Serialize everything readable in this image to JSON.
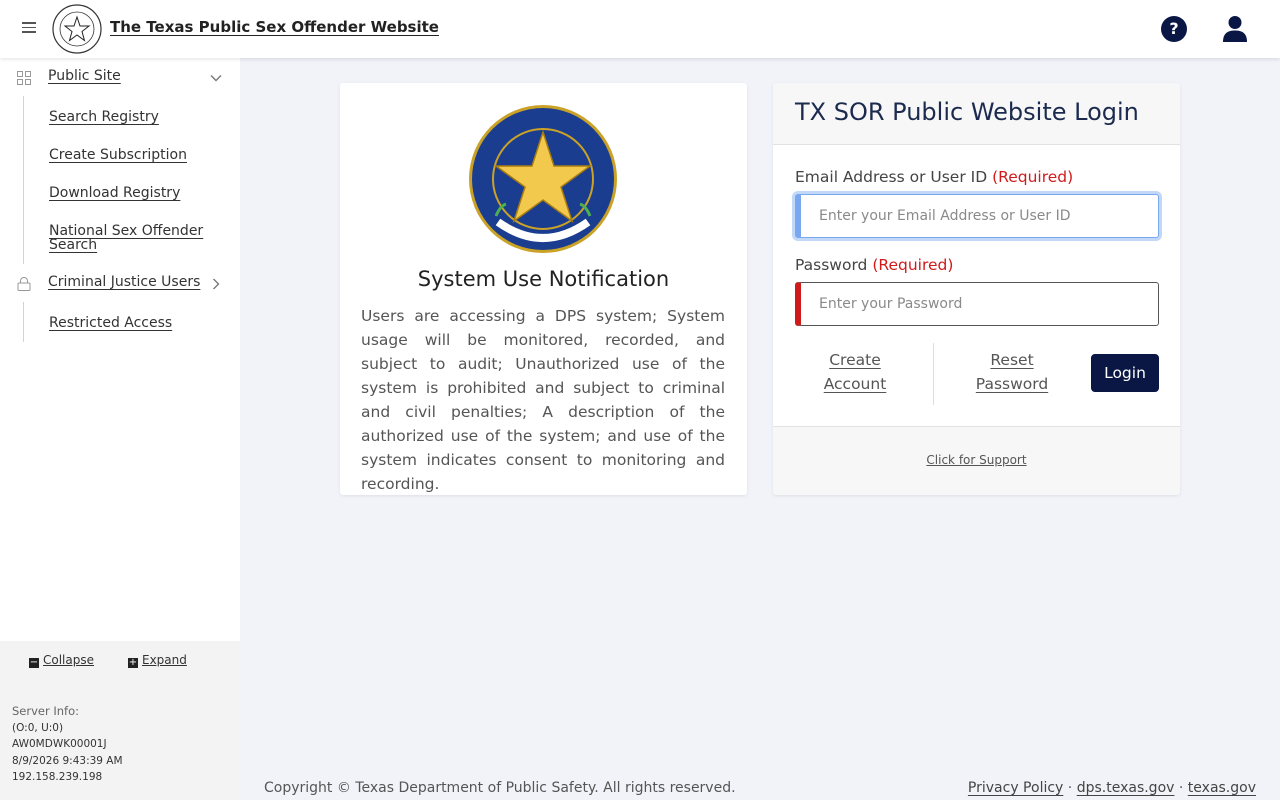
{
  "header": {
    "site_title": "The Texas Public Sex Offender Website",
    "menu_icon": "hamburger-icon",
    "help_icon": "question-icon",
    "help_glyph": "?",
    "user_icon": "user-icon"
  },
  "sidebar": {
    "groups": [
      {
        "label": "Public Site",
        "icon": "grid-icon",
        "expanded": true,
        "links": [
          "Search Registry",
          "Create Subscription",
          "Download Registry",
          "National Sex Offender Search"
        ]
      },
      {
        "label": "Criminal Justice Users",
        "icon": "lock-icon",
        "expanded": false,
        "links": [
          "Restricted Access"
        ]
      }
    ],
    "collapse_label": "Collapse",
    "expand_label": "Expand",
    "server_info": {
      "heading": "Server Info:",
      "lines": [
        "(O:0, U:0)",
        "AW0MDWK00001J",
        "8/9/2026 9:43:39 AM",
        "192.158.239.198"
      ]
    }
  },
  "notice": {
    "title": "System Use Notification",
    "body": "Users are accessing a DPS system; System usage will be monitored, recorded, and subject to audit; Unauthorized use of the system is prohibited and subject to criminal and civil penalties; A description of the authorized use of the system; and use of the system indicates consent to monitoring and recording."
  },
  "login": {
    "title": "TX SOR Public Website Login",
    "email_label": "Email Address or User ID",
    "email_required": "(Required)",
    "email_placeholder": "Enter your Email Address or User ID",
    "email_value": "",
    "password_label": "Password",
    "password_required": "(Required)",
    "password_placeholder": "Enter your Password",
    "password_value": "",
    "create_account": [
      "Create",
      "Account"
    ],
    "reset_password": [
      "Reset",
      "Password"
    ],
    "login_button": "Login",
    "support_link": "Click for Support"
  },
  "footer": {
    "copyright": "Copyright © Texas Department of Public Safety. All rights reserved.",
    "links": [
      "Privacy Policy",
      "dps.texas.gov",
      "texas.gov"
    ],
    "separator": "·"
  },
  "colors": {
    "navy": "#0a1744",
    "required_red": "#d11a1a",
    "focus_blue": "#79a8f0",
    "page_bg": "#f1f3f8"
  }
}
